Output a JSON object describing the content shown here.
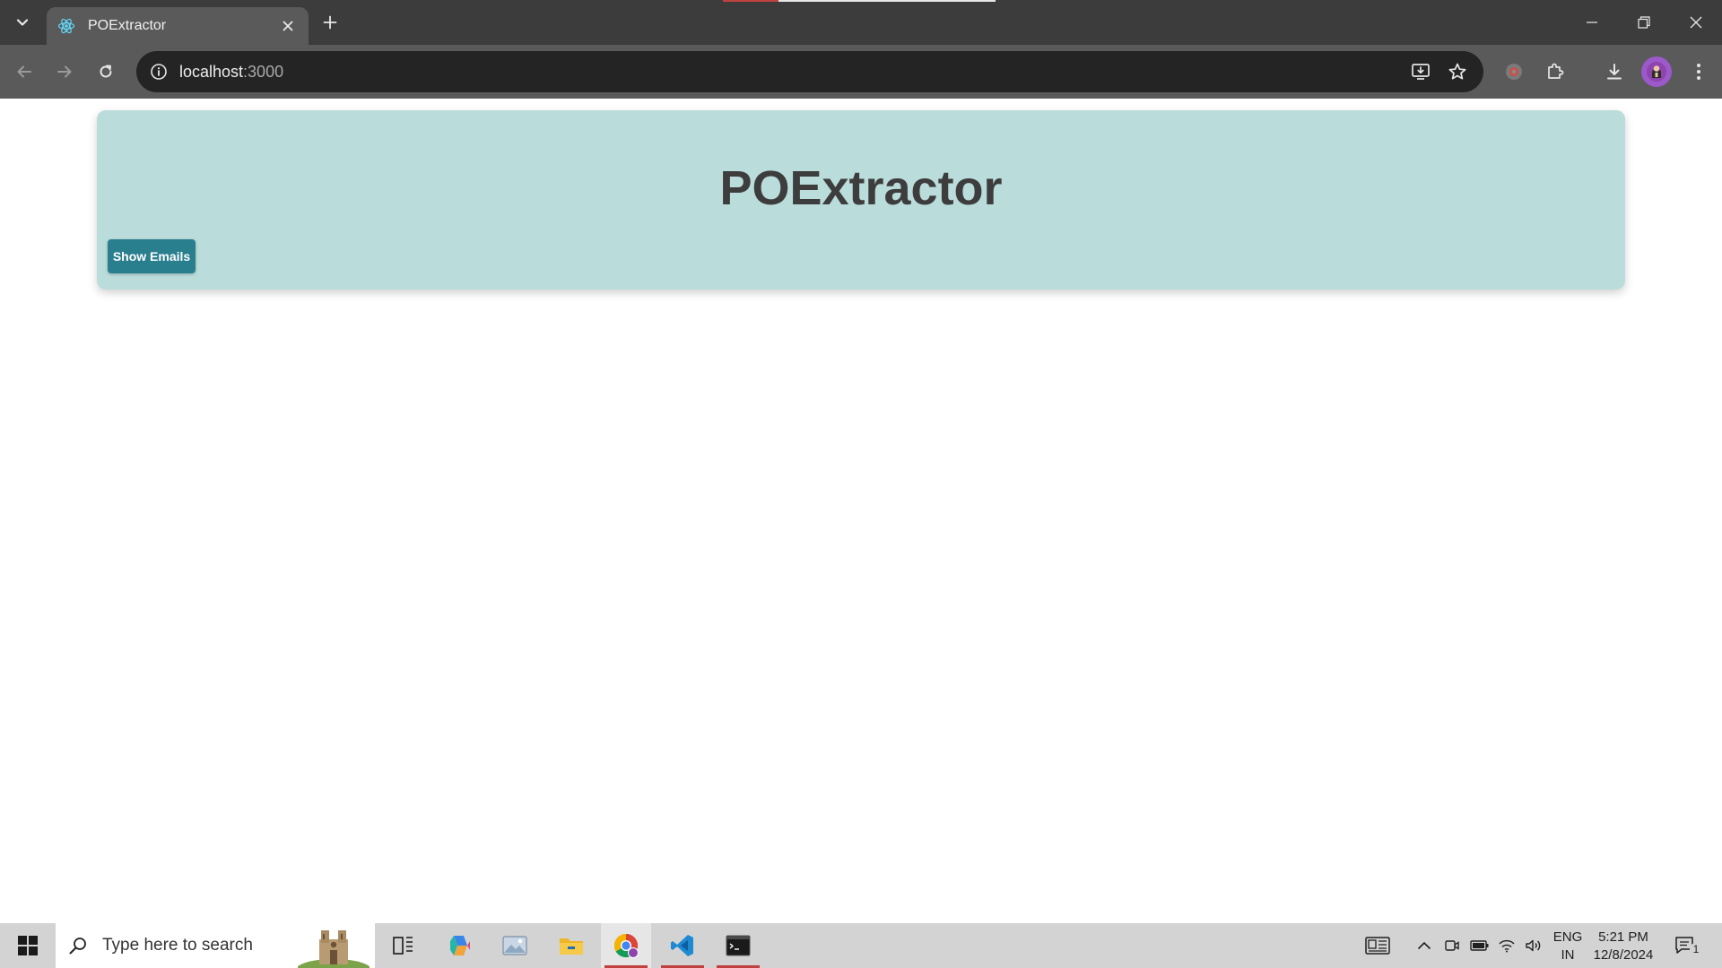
{
  "browser": {
    "tab_title": "POExtractor",
    "url_host": "localhost",
    "url_port": ":3000"
  },
  "icons": {
    "tab_search": "chevron-down-icon",
    "favicon": "react-icon",
    "close": "close-icon",
    "new_tab": "plus-icon",
    "minimize": "minimize-icon",
    "restore": "restore-icon",
    "window_close": "close-icon",
    "back": "back-arrow-icon",
    "forward": "forward-arrow-icon",
    "reload": "reload-icon",
    "site_info": "info-icon",
    "install": "install-app-icon",
    "bookmark": "star-icon",
    "extension_a": "extension-icon",
    "extensions": "puzzle-icon",
    "downloads": "download-icon",
    "profile": "avatar-icon",
    "menu": "kebab-menu-icon"
  },
  "app": {
    "title": "POExtractor",
    "show_emails_label": "Show Emails"
  },
  "taskbar": {
    "search_placeholder": "Type here to search",
    "lang_line1": "ENG",
    "lang_line2": "IN",
    "time": "5:21 PM",
    "date": "12/8/2024",
    "notification_count": "1"
  },
  "colors": {
    "header_bg": "#badcdb",
    "button_bg": "#2a7f8f",
    "title_text": "#3d3d3d",
    "tab_strip": "#3c3c3c",
    "toolbar": "#5a5a5a"
  }
}
